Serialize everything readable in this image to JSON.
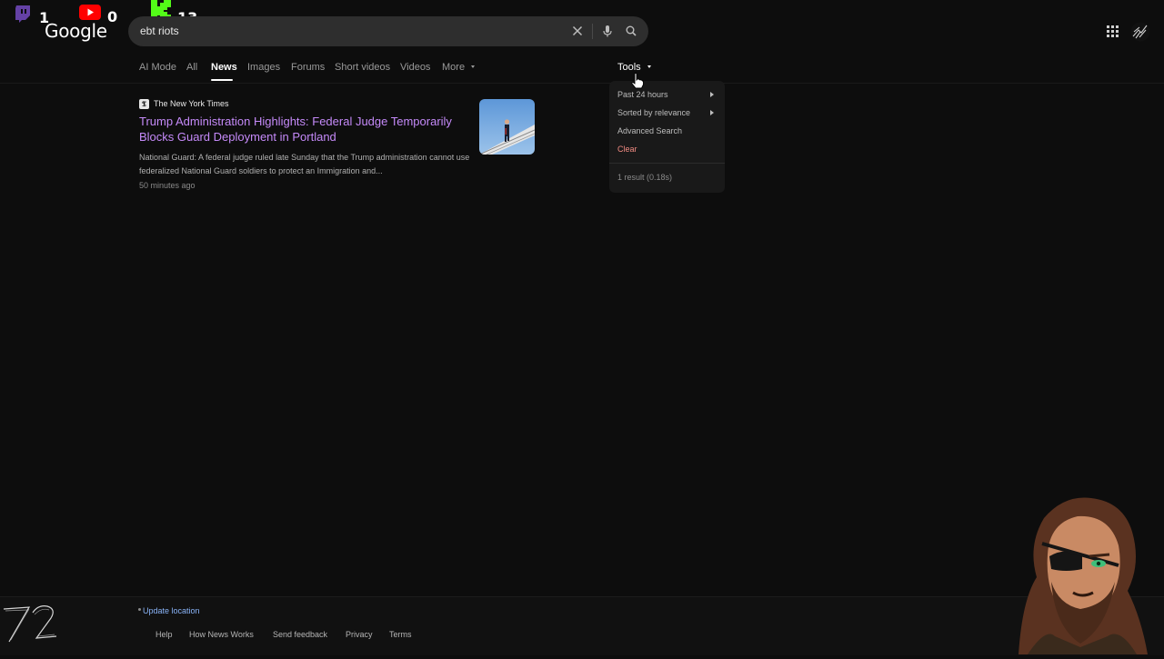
{
  "overlay": {
    "twitch_count": "1",
    "youtube_count": "0",
    "kick_count": "13"
  },
  "logo": "Google",
  "search": {
    "query": "ebt riots"
  },
  "tabs": [
    {
      "label": "AI Mode"
    },
    {
      "label": "All"
    },
    {
      "label": "News"
    },
    {
      "label": "Images"
    },
    {
      "label": "Forums"
    },
    {
      "label": "Short videos"
    },
    {
      "label": "Videos"
    },
    {
      "label": "More"
    }
  ],
  "tools_label": "Tools",
  "result": {
    "source": "The New York Times",
    "title": "Trump Administration Highlights: Federal Judge Temporarily Blocks Guard Deployment in Portland",
    "snippet": "National Guard: A federal judge ruled late Sunday that the Trump administration cannot use federalized National Guard soldiers to protect an Immigration and...",
    "time": "50 minutes ago"
  },
  "tools_menu": {
    "items": [
      {
        "label": "Past 24 hours"
      },
      {
        "label": "Sorted by relevance"
      },
      {
        "label": "Advanced Search"
      },
      {
        "label": "Clear"
      }
    ],
    "result_count": "1 result (0.18s)"
  },
  "footer": {
    "update_location": "Update location",
    "links": [
      {
        "label": "Help"
      },
      {
        "label": "How News Works"
      },
      {
        "label": "Send feedback"
      },
      {
        "label": "Privacy"
      },
      {
        "label": "Terms"
      }
    ]
  },
  "colors": {
    "background": "#0d0d0d",
    "visited_link": "#c58af9",
    "clear_red": "#f28b82",
    "link_blue": "#8ab4f8"
  }
}
